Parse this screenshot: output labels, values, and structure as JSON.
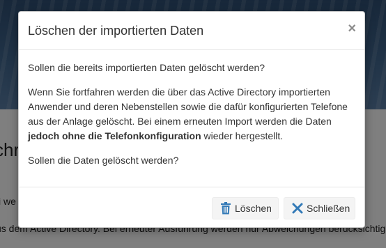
{
  "background": {
    "heading_fragment": "chr",
    "line1_fragment": "i we",
    "line2_fragment": "us dem Active Directory. Bei erneuter Ausführung werden nur Abweichungen berücksichtig"
  },
  "modal": {
    "title": "Löschen der importierten Daten",
    "close_glyph": "×",
    "body": {
      "question": "Sollen die bereits importierten Daten gelöscht werden?",
      "paragraph_before_bold": "Wenn Sie fortfahren werden die über das Active Directory importierten Anwender und deren Nebenstellen sowie die dafür konfigurierten Telefone aus der Anlage gelöscht. Bei einem erneuten Import werden die Daten ",
      "paragraph_bold": "jedoch ohne die Telefonkonfiguration",
      "paragraph_after_bold": " wieder hergestellt.",
      "confirm": "Sollen die Daten gelöscht werden?"
    },
    "buttons": {
      "delete_label": "Löschen",
      "delete_icon": "trash-icon",
      "close_label": "Schließen",
      "close_icon": "times-icon"
    }
  },
  "colors": {
    "icon_blue": "#337ab7",
    "overlay": "rgba(0,0,0,0.5)"
  }
}
